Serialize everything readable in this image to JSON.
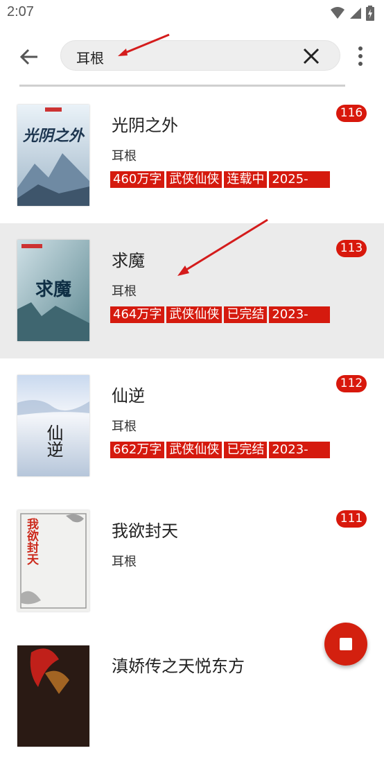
{
  "status_bar": {
    "time": "2:07",
    "icons": [
      "wifi-icon",
      "signal-icon",
      "battery-charging-icon"
    ]
  },
  "search": {
    "query": "耳根",
    "back_icon": "back-arrow-icon",
    "clear_icon": "close-icon",
    "menu_icon": "more-vert-icon"
  },
  "books": [
    {
      "title": "光阴之外",
      "author": "耳根",
      "word_count": "460万字",
      "genre": "武侠仙侠",
      "status": "连载中",
      "year": "2025-",
      "count": "116",
      "cover_text": "光阴之外"
    },
    {
      "title": "求魔",
      "author": "耳根",
      "word_count": "464万字",
      "genre": "武侠仙侠",
      "status": "已完结",
      "year": "2023-",
      "count": "113",
      "cover_text": "求魔"
    },
    {
      "title": "仙逆",
      "author": "耳根",
      "word_count": "662万字",
      "genre": "武侠仙侠",
      "status": "已完结",
      "year": "2023-",
      "count": "112",
      "cover_text": "仙逆"
    },
    {
      "title": "我欲封天",
      "author": "耳根",
      "count": "111",
      "cover_text": "我欲封天"
    },
    {
      "title": "滇娇传之天悦东方"
    }
  ],
  "colors": {
    "accent": "#d51a0e",
    "selected_row": "#ebebeb",
    "search_bg": "#eeeeee"
  },
  "fab": {
    "icon": "stop-icon"
  }
}
